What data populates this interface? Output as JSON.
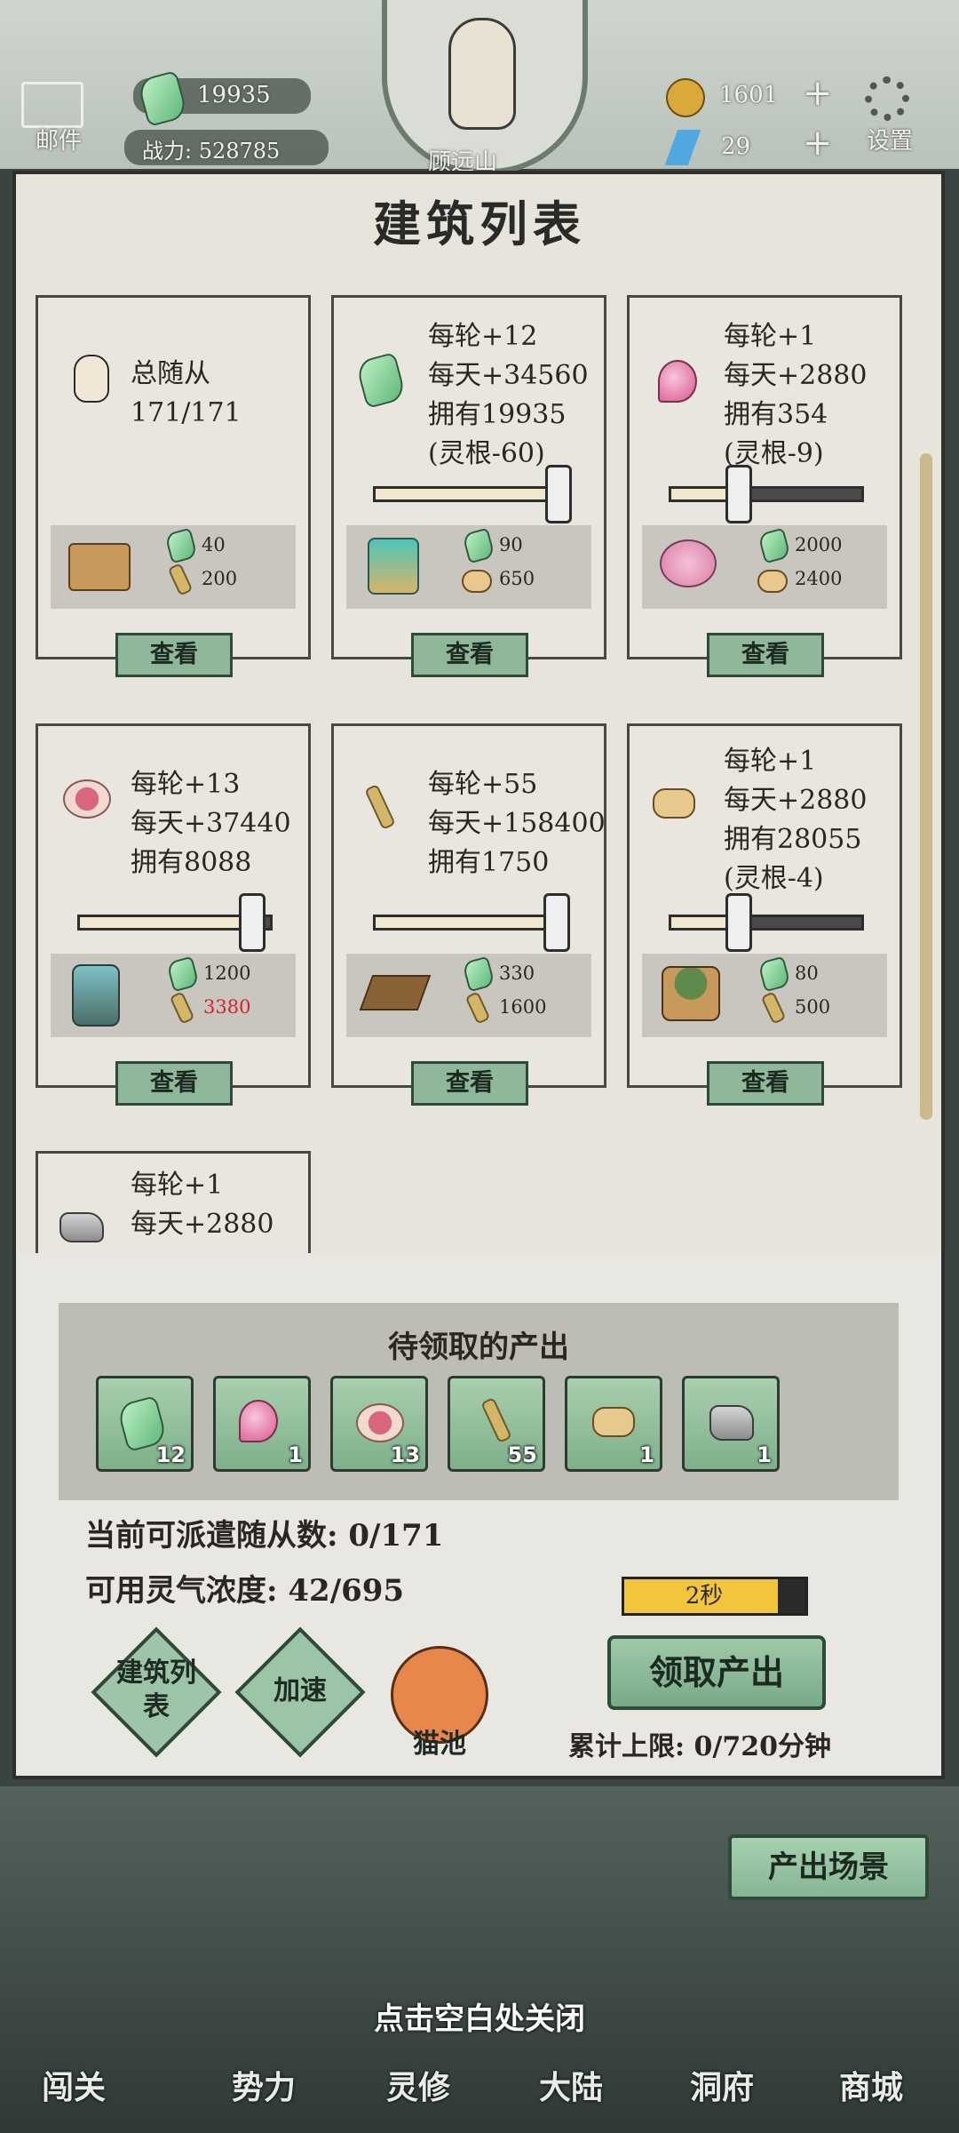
{
  "top_bar": {
    "mail_label": "邮件",
    "jade_count": "19935",
    "power_label": "战力: 528785",
    "player_name": "顾远山",
    "coin_count": "1601",
    "energy_count": "29",
    "settings_label": "设置"
  },
  "panel_title": "建筑列表",
  "cards": [
    {
      "lines": [
        "总随从",
        "171/171"
      ],
      "cost_jade": "40",
      "cost_wood": "200",
      "view": "查看"
    },
    {
      "lines": [
        "每轮+12",
        "每天+34560",
        "拥有19935",
        "(灵根-60)"
      ],
      "cost_jade": "90",
      "cost_wood": "650",
      "view": "查看",
      "slider": 1.0
    },
    {
      "lines": [
        "每轮+1",
        "每天+2880",
        "拥有354",
        "(灵根-9)"
      ],
      "cost_jade": "2000",
      "cost_wood": "2400",
      "view": "查看",
      "slider": 0.35
    },
    {
      "lines": [
        "每轮+13",
        "每天+37440",
        "拥有8088"
      ],
      "cost_jade": "1200",
      "cost_wood": "3380",
      "view": "查看",
      "slider": 0.95
    },
    {
      "lines": [
        "每轮+55",
        "每天+158400",
        "拥有1750"
      ],
      "cost_jade": "330",
      "cost_wood": "1600",
      "view": "查看",
      "slider": 1.0
    },
    {
      "lines": [
        "每轮+1",
        "每天+2880",
        "拥有28055",
        "(灵根-4)"
      ],
      "cost_jade": "80",
      "cost_wood": "500",
      "view": "查看",
      "slider": 0.35
    },
    {
      "lines": [
        "每轮+1",
        "每天+2880"
      ]
    }
  ],
  "pending": {
    "title": "待领取的产出",
    "items": [
      {
        "icon": "jade-icon",
        "count": "12"
      },
      {
        "icon": "peach-icon",
        "count": "1"
      },
      {
        "icon": "pill-icon",
        "count": "13"
      },
      {
        "icon": "wheat-icon",
        "count": "55"
      },
      {
        "icon": "wood-icon",
        "count": "1"
      },
      {
        "icon": "stone-icon",
        "count": "1"
      }
    ]
  },
  "status": {
    "followers": "当前可派遣随从数: 0/171",
    "spirit": "可用灵气浓度: 42/695",
    "timer": "2秒",
    "timer_fill": 0.85,
    "claim": "领取产出",
    "limit": "累计上限: 0/720分钟"
  },
  "actions": {
    "building_list": "建筑列表",
    "speed_up": "加速",
    "cat_pool": "猫池"
  },
  "scene_button": "产出场景",
  "close_hint": "点击空白处关闭",
  "bottom_nav": [
    "闯关",
    "势力",
    "灵修",
    "大陆",
    "洞府",
    "商城"
  ],
  "colors": {
    "accent_green": "#8fb79a",
    "panel_bg": "#e7e4dc",
    "warning_red": "#d0252b",
    "timer_yellow": "#f2c53d"
  }
}
